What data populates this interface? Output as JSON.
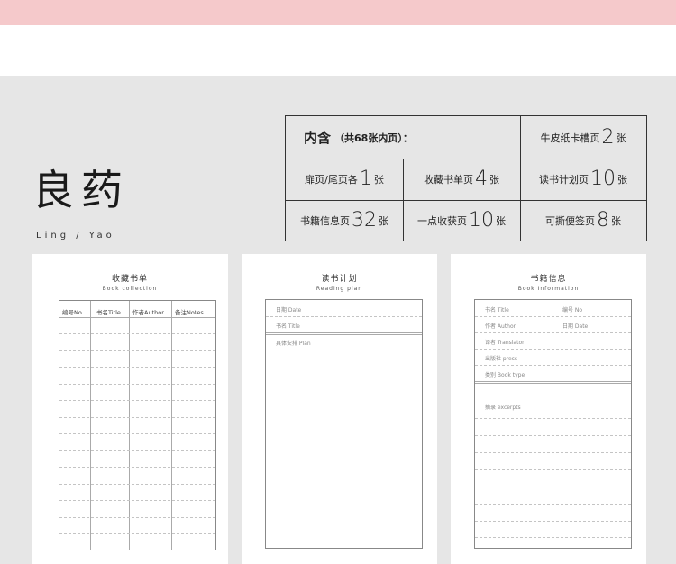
{
  "brand": {
    "title": "良药",
    "subtitle": "Ling / Yao"
  },
  "contents": {
    "heading": "内含",
    "heading_note": "（共68张内页）：",
    "items": [
      {
        "text_before": "牛皮纸卡槽页",
        "num": "2",
        "unit": "张"
      },
      {
        "text_before": "扉页/尾页各",
        "num": "1",
        "unit": "张"
      },
      {
        "text_before": "收藏书单页",
        "num": "4",
        "unit": "张"
      },
      {
        "text_before": "读书计划页",
        "num": "10",
        "unit": "张"
      },
      {
        "text_before": "书籍信息页",
        "num": "32",
        "unit": "张"
      },
      {
        "text_before": "一点收获页",
        "num": "10",
        "unit": "张"
      },
      {
        "text_before": "可撕便签页",
        "num": "8",
        "unit": "张"
      }
    ]
  },
  "pages": {
    "collection": {
      "title": "收藏书单",
      "subtitle": "Book collection",
      "columns": [
        "编号No",
        "书名Title",
        "作者Author",
        "备注Notes"
      ]
    },
    "plan": {
      "title": "读书计划",
      "subtitle": "Reading plan",
      "fields": [
        "日期 Date",
        "书名 Title",
        "具体安排  Plan"
      ]
    },
    "info": {
      "title": "书籍信息",
      "subtitle": "Book Information",
      "fields": [
        "书名 Title",
        "编号 No",
        "作者 Author",
        "日期 Date",
        "译者 Translator",
        "出版社  press",
        "类别 Book type",
        "摘录 excerpts"
      ]
    }
  }
}
